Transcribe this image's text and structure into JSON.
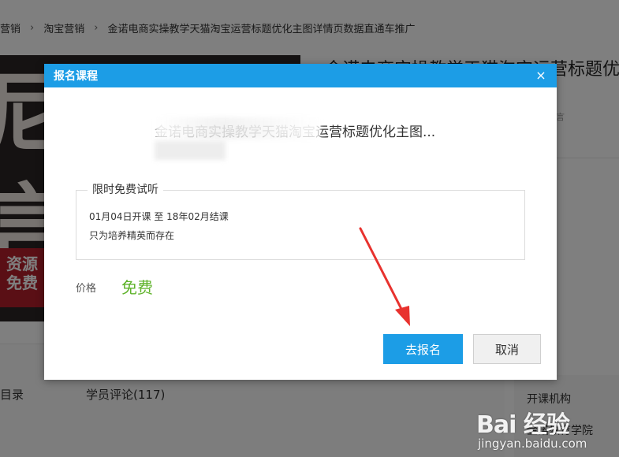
{
  "breadcrumb": [
    "营销",
    "淘宝营销",
    "金诺电商实操教学天猫淘宝运营标题优化主图详情页数据直通车推广"
  ],
  "hero": {
    "chars": [
      "尼点",
      "言"
    ],
    "stripe_text": "资源免费"
  },
  "course": {
    "title": "金诺电商实操教学天猫淘宝运营标题优化",
    "side_text": "言"
  },
  "tabs": {
    "catalog": "目录",
    "reviews": "学员评论(117)"
  },
  "institution": {
    "title": "开课机构",
    "name": "金诺教育学院"
  },
  "modal": {
    "title": "报名课程",
    "close": "×",
    "course_name": "金诺电商实操教学天猫淘宝运营标题优化主图...",
    "trial": {
      "legend": "限时免费试听",
      "dates": "01月04日开课 至 18年02月结课",
      "slogan": "只为培养精英而存在"
    },
    "price_label": "价格",
    "price_value": "免费",
    "enroll_button": "去报名",
    "cancel_button": "取消"
  },
  "watermark": {
    "logo": "Bai 经验",
    "url": "jingyan.baidu.com"
  },
  "colors": {
    "accent": "#1c9de6",
    "price": "#5fb32b",
    "arrow": "#e8322e"
  }
}
